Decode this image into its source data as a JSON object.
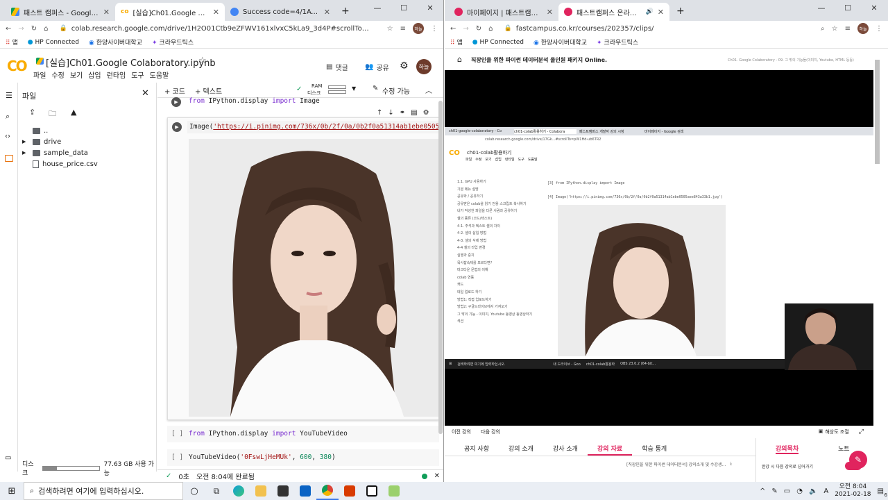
{
  "left_window": {
    "tabs": [
      {
        "label": "패스트 캠퍼스 - Google Drive",
        "active": false
      },
      {
        "label": "[실습]Ch01.Google Colaboratory",
        "active": true
      },
      {
        "label": "Success code=4/1AY0e-g4x3eT",
        "active": false
      }
    ],
    "url": "colab.research.google.com/drive/1H2O01Ctb9eZFWV161xlvxC5kLa9_3d4P#scrollTo=Ps-bi-_3RTW_",
    "bookmarks": [
      "앱",
      "HP Connected",
      "한양사이버대학교",
      "크라우드틱스"
    ],
    "profile_label": "하늘",
    "colab_logo": "CO",
    "notebook_title": "[실습]Ch01.Google Colaboratory.ipynb",
    "menu": [
      "파일",
      "수정",
      "보기",
      "삽입",
      "런타임",
      "도구",
      "도움말"
    ],
    "header_buttons": {
      "comment": "댓글",
      "share": "공유",
      "avatar": "하늘"
    },
    "sidebar": {
      "title": "파일",
      "tree": [
        {
          "label": "..",
          "type": "folder",
          "expandable": false
        },
        {
          "label": "drive",
          "type": "folder",
          "expandable": true
        },
        {
          "label": "sample_data",
          "type": "folder",
          "expandable": true
        },
        {
          "label": "house_price.csv",
          "type": "file",
          "expandable": false
        }
      ],
      "disk_label": "디스크",
      "disk_text": "77.63 GB 사용 가능",
      "disk_fraction": 0.25
    },
    "toolbar": {
      "add_code": "+ 코드",
      "add_text": "+ 텍스트",
      "ram": "RAM",
      "disk": "디스크",
      "edit_mode": "수정 가능"
    },
    "cells": [
      {
        "prompt": "",
        "parts": [
          {
            "t": "from",
            "c": "kw"
          },
          {
            "t": " IPython.display ",
            "c": ""
          },
          {
            "t": "import",
            "c": "kw"
          },
          {
            "t": " Image",
            "c": ""
          }
        ]
      },
      {
        "prompt": "",
        "parts": [
          {
            "t": "Image(",
            "c": ""
          },
          {
            "t": "'https://i.pinimg.com/736x/0b/2f/0a/0b2f0a51314ab1ebe0505aee843a33b1.jp",
            "c": "str"
          }
        ]
      },
      {
        "prompt": "[ ]",
        "parts": [
          {
            "t": "from",
            "c": "kw"
          },
          {
            "t": " IPython.display ",
            "c": ""
          },
          {
            "t": "import",
            "c": "kw"
          },
          {
            "t": " YouTubeVideo",
            "c": ""
          }
        ]
      },
      {
        "prompt": "[ ]",
        "parts": [
          {
            "t": "YouTubeVideo(",
            "c": ""
          },
          {
            "t": "'0FswLjHeMUk'",
            "c": "str2"
          },
          {
            "t": ", ",
            "c": ""
          },
          {
            "t": "600",
            "c": "num"
          },
          {
            "t": ", ",
            "c": ""
          },
          {
            "t": "380",
            "c": "num"
          },
          {
            "t": ")",
            "c": ""
          }
        ]
      }
    ],
    "status": {
      "check": "✓",
      "seconds": "0초",
      "completed": "오전 8:04에 완료됨"
    }
  },
  "right_window": {
    "tabs": [
      {
        "label": "마이페이지 | 패스트캠퍼스",
        "active": false
      },
      {
        "label": "패스트캠퍼스 온라인 강의",
        "active": true
      }
    ],
    "url": "fastcampus.co.kr/courses/202357/clips/",
    "bookmarks": [
      "앱",
      "HP Connected",
      "한양사이버대학교",
      "크라우드틱스"
    ],
    "profile_label": "하늘",
    "course_title": "직장인을 위한 파이썬 데이터분석 올인원 패키지 Online.",
    "clip_title": "Ch01. Google Colaboratory - 09. 그 밖의 기능들(이미지, Youtube, HTML 등등)",
    "video": {
      "tabs": [
        "ch01-google-colaboratory - Co",
        "ch01-colab활용하기 - Colabora",
        "패스트캠퍼스 개발자 강의 시청",
        "마이페이지 - Google 검색"
      ],
      "url_text": "colab.research.google.com/drive/17Gk...#scrollTo=pW1Hd-ub6TR2",
      "notebook_title": "ch01-colab활용하기",
      "menu": [
        "파일",
        "수정",
        "보기",
        "삽입",
        "런타임",
        "도구",
        "도움말"
      ],
      "toc": [
        "1.1. GPU 사용하기",
        "기본 메뉴 설명",
        "공유와 / 공유하기",
        "공유받은 colab을 읽기 전용 스크립트 복사하기",
        "내가 작성한 파일을 다른 사람과 공유하기",
        "셀의 종류 (코드/텍스트)",
        "4-1. 주석과 텍스트 셀의 차이",
        "4-2. 셀의 삽입 방법",
        "4-3. 셀의 삭제 방법",
        "4-4 셀의 타입 변경",
        "실행과 중지",
        "목사잡숙제를 모르다면?",
        "마크다운 문법의 이해",
        "colab 연동",
        "캐드",
        "데일 업로드 하기",
        "방법1: 직접 업로드하기",
        "방법2: 구글드라이브에서 가져오기",
        "그 밖의 기능 - 이미지, Youtube 동영상 동영상하기",
        "섹션"
      ],
      "code1": "from IPython.display import Image",
      "code2": "Image('https://i.pinimg.com/736x/0b/2f/0a/0b2f0a51314ab1ebe0505aee843a33b1.jpg')",
      "prompt1": "[3]",
      "prompt2": "[4]",
      "taskbar_search": "검색하려면 여기에 입력하십시오.",
      "taskbar_items": [
        "내 드라이브 - Goo",
        "ch01-colab활용하",
        "OBS 23.0.2 (64-bit..."
      ]
    },
    "controls": {
      "prev": "이전 강의",
      "next": "다음 강의",
      "caption": "해상도 조절"
    },
    "course_tabs": [
      "공지 사항",
      "강의 소개",
      "강사 소개",
      "강의 자료",
      "학습 통계"
    ],
    "active_course_tab": "강의 자료",
    "attachment": "[직장인을 위한 파이썬 데이터분석] 강의소개 및 수강생...",
    "side_tabs": [
      "강의목차",
      "노트"
    ],
    "autoplay": "완강 시 다음 강의로 넘어가기"
  },
  "taskbar": {
    "search_placeholder": "검색하려면 여기에 입력하십시오.",
    "time": "오전 8:04",
    "date": "2021-02-18",
    "notification_count": "6"
  }
}
